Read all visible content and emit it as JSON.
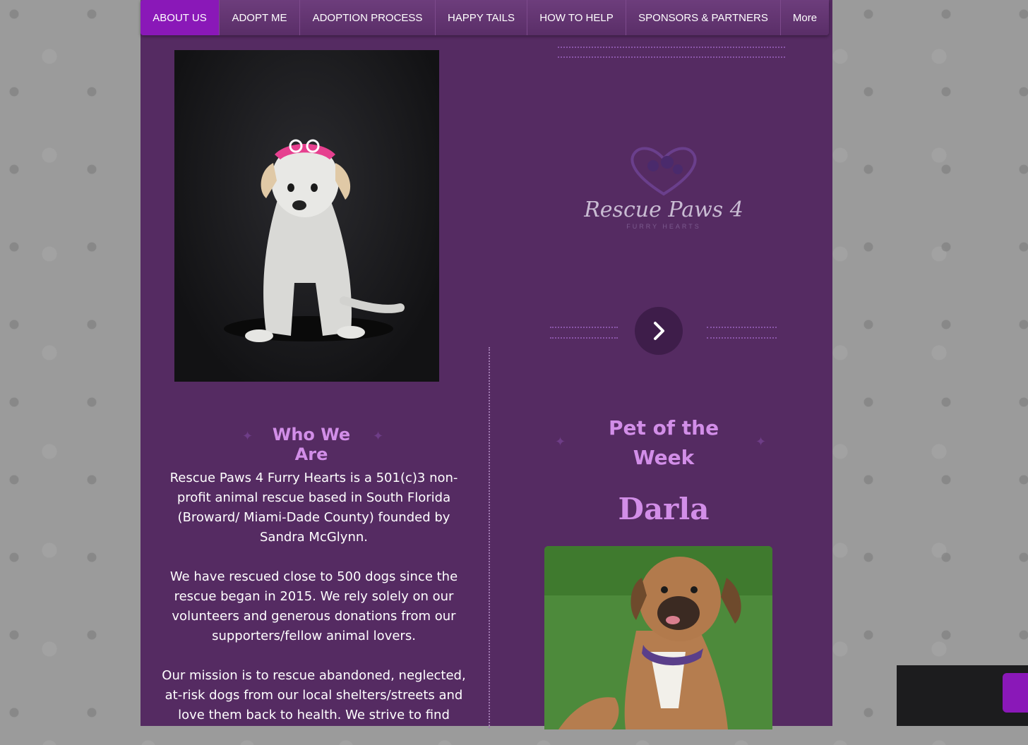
{
  "nav": {
    "items": [
      {
        "label": "ABOUT US",
        "active": true
      },
      {
        "label": "ADOPT ME",
        "active": false
      },
      {
        "label": "ADOPTION PROCESS",
        "active": false
      },
      {
        "label": "HAPPY TAILS",
        "active": false
      },
      {
        "label": "HOW TO HELP",
        "active": false
      },
      {
        "label": "SPONSORS & PARTNERS",
        "active": false
      },
      {
        "label": "More",
        "active": false
      }
    ]
  },
  "logo": {
    "text": "Rescue Paws 4",
    "tagline": "FURRY HEARTS",
    "icon": "heart-paws-icon"
  },
  "about": {
    "heading": "Who We Are",
    "paragraphs": [
      "Rescue Paws 4 Furry Hearts is a 501(c)3 non-profit animal rescue based in South Florida (Broward/ Miami-Dade County) founded by Sandra McGlynn.",
      "We have rescued close to 500 dogs since the rescue began in 2015. We rely solely on our volunteers and generous donations from our supporters/fellow animal lovers.",
      "Our mission is to rescue abandoned, neglected, at-risk dogs from our local shelters/streets and love them back to health. We strive to find"
    ]
  },
  "pet_of_week": {
    "heading_line1": "Pet of the",
    "heading_line2": "Week",
    "name": "Darla"
  },
  "colors": {
    "panel": "#552b62",
    "accent": "#8a18b8",
    "heading": "#d28ee8"
  }
}
